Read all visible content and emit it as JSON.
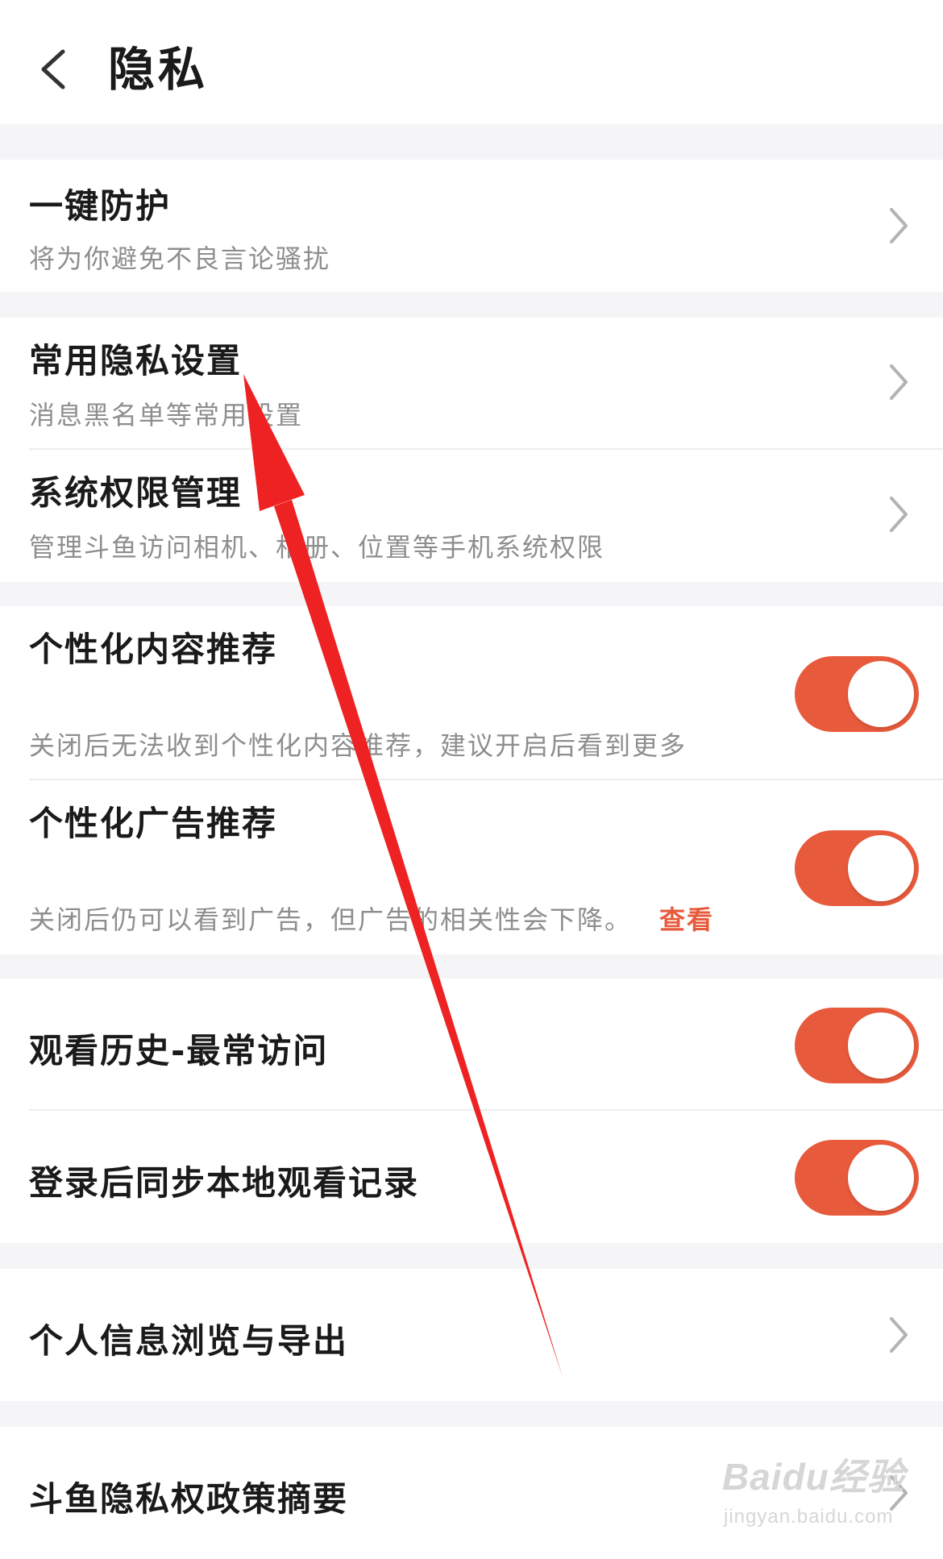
{
  "header": {
    "title": "隐私"
  },
  "rows": {
    "one_click_protection": {
      "title": "一键防护",
      "subtitle": "将为你避免不良言论骚扰"
    },
    "common_privacy": {
      "title": "常用隐私设置",
      "subtitle": "消息黑名单等常用设置"
    },
    "system_permissions": {
      "title": "系统权限管理",
      "subtitle": "管理斗鱼访问相机、相册、位置等手机系统权限"
    },
    "personalized_content": {
      "title": "个性化内容推荐",
      "subtitle": "关闭后无法收到个性化内容推荐，建议开启后看到更多",
      "on": true
    },
    "personalized_ads": {
      "title": "个性化广告推荐",
      "subtitle": "关闭后仍可以看到广告，但广告的相关性会下降。",
      "link": "查看",
      "on": true
    },
    "watch_history": {
      "title": "观看历史-最常访问",
      "on": true
    },
    "sync_local": {
      "title": "登录后同步本地观看记录",
      "on": true
    },
    "personal_info": {
      "title": "个人信息浏览与导出"
    },
    "privacy_policy": {
      "title": "斗鱼隐私权政策摘要"
    }
  },
  "watermark": {
    "brand": "Baidu经验",
    "url": "jingyan.baidu.com"
  },
  "colors": {
    "accent": "#e85a3c",
    "annotation_arrow": "#ee2222"
  },
  "icons": {
    "back": "chevron-left-icon",
    "row_arrow": "chevron-right-icon"
  }
}
